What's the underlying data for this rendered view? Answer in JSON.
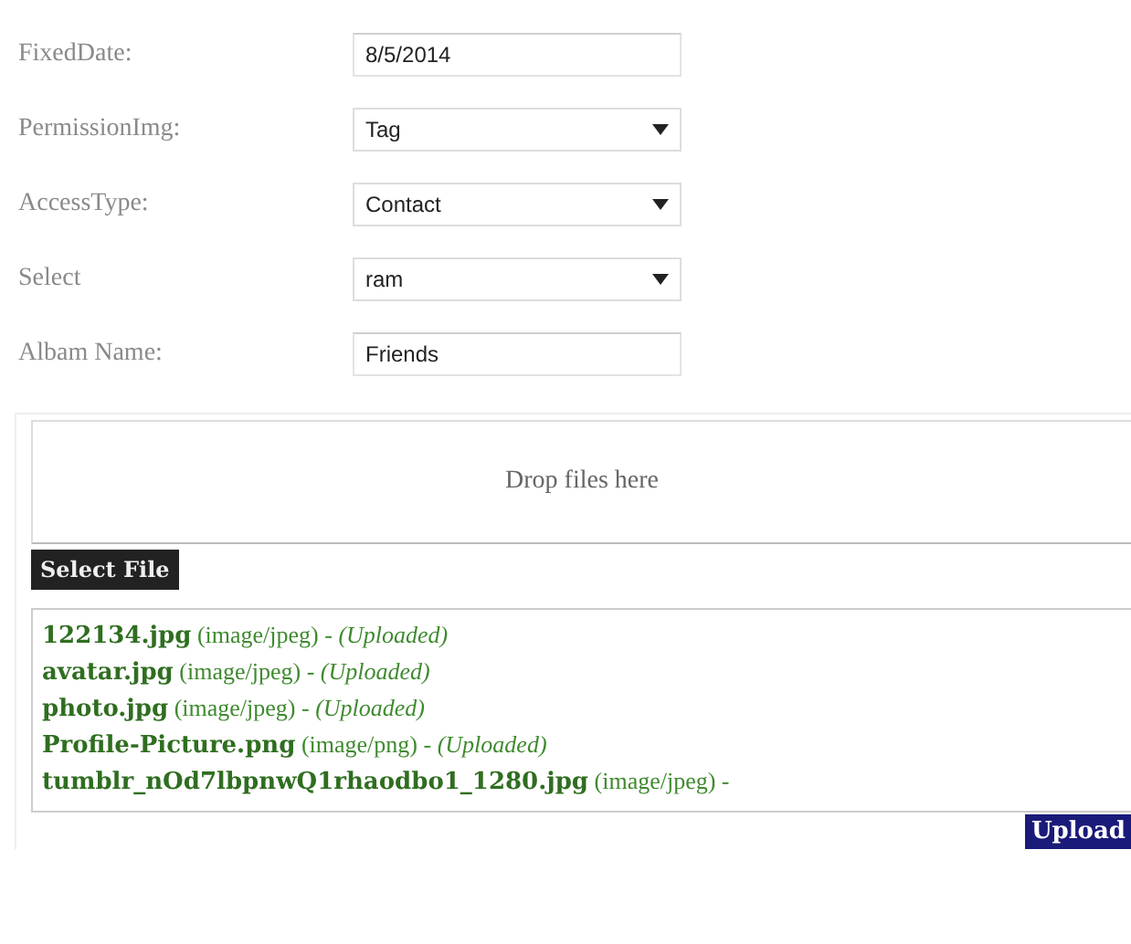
{
  "form": [
    {
      "label": "FixedDate:",
      "kind": "text",
      "value": "8/5/2014"
    },
    {
      "label": "PermissionImg:",
      "kind": "select",
      "value": "Tag"
    },
    {
      "label": "AccessType:",
      "kind": "select",
      "value": "Contact"
    },
    {
      "label": "Select",
      "kind": "select",
      "value": "ram"
    },
    {
      "label": "Albam Name:",
      "kind": "text",
      "value": "Friends"
    }
  ],
  "uploader": {
    "drop_text": "Drop files here",
    "select_button": "Select File",
    "files": [
      {
        "name": "122134.jpg",
        "type": "(image/jpeg)",
        "separator": "-",
        "status": "(Uploaded)"
      },
      {
        "name": "avatar.jpg",
        "type": "(image/jpeg)",
        "separator": "-",
        "status": "(Uploaded)"
      },
      {
        "name": "photo.jpg",
        "type": "(image/jpeg)",
        "separator": "-",
        "status": "(Uploaded)"
      },
      {
        "name": "Profile-Picture.png",
        "type": "(image/png)",
        "separator": "-",
        "status": "(Uploaded)"
      },
      {
        "name": "tumblr_nOd7lbpnwQ1rhaodbo1_1280.jpg",
        "type": "(image/jpeg)",
        "separator": "-"
      }
    ],
    "upload_button": "Upload"
  }
}
